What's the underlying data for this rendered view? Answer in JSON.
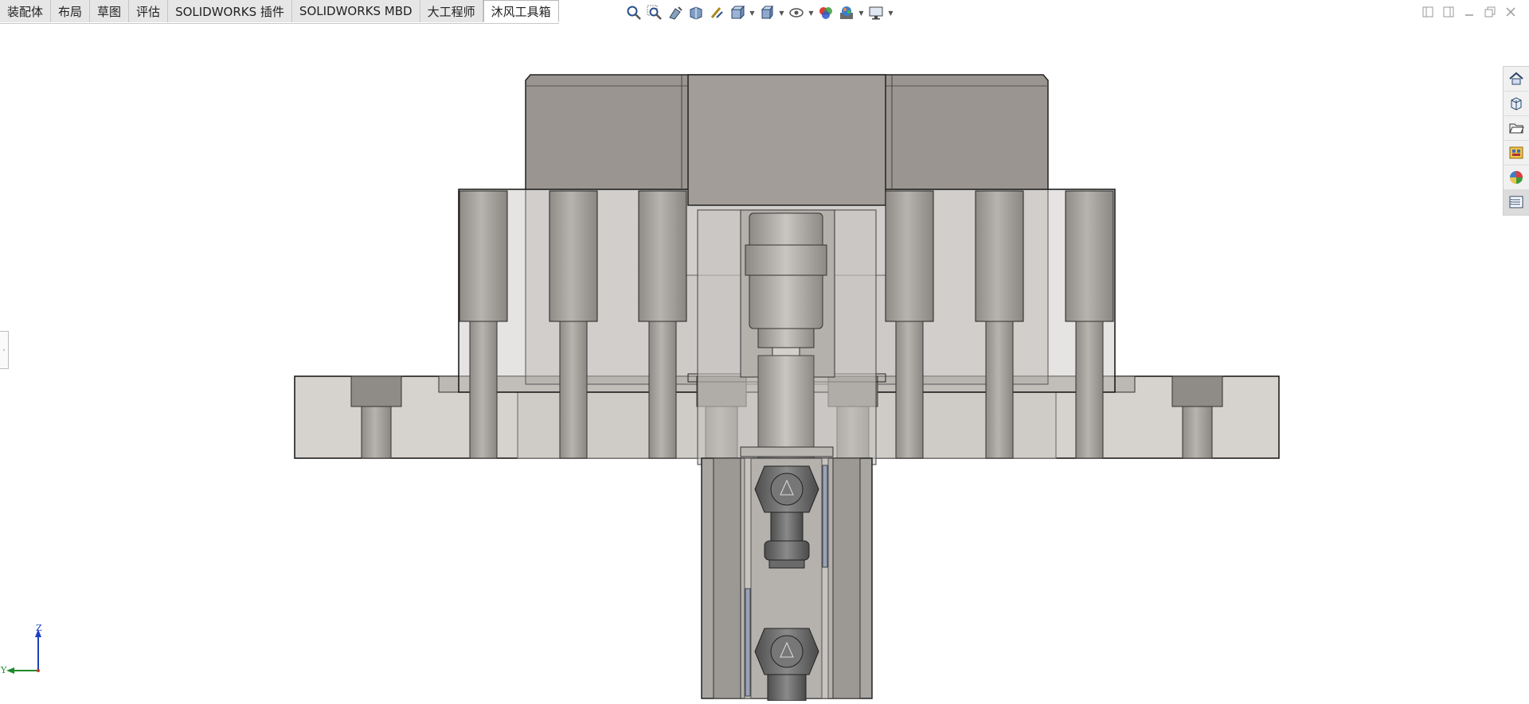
{
  "tabs": [
    {
      "label": "装配体",
      "active": false
    },
    {
      "label": "布局",
      "active": false
    },
    {
      "label": "草图",
      "active": false
    },
    {
      "label": "评估",
      "active": false
    },
    {
      "label": "SOLIDWORKS 插件",
      "active": false
    },
    {
      "label": "SOLIDWORKS MBD",
      "active": false
    },
    {
      "label": "大工程师",
      "active": false
    },
    {
      "label": "沐风工具箱",
      "active": true
    }
  ],
  "view_toolbar": {
    "icons": [
      "zoom-to-fit-icon",
      "zoom-to-area-icon",
      "previous-view-icon",
      "section-view-icon",
      "dynamic-annotation-icon",
      "view-orientation-icon",
      "display-style-icon",
      "hide-show-items-icon",
      "edit-appearance-icon",
      "apply-scene-icon",
      "view-settings-icon"
    ]
  },
  "task_pane": {
    "icons": [
      "home-icon",
      "parts-library-icon",
      "file-explorer-icon",
      "view-palette-icon",
      "appearances-icon",
      "custom-properties-icon"
    ]
  },
  "triad": {
    "axis_vertical": "Z",
    "axis_horizontal": "Y"
  },
  "colors": {
    "tab_bg": "#e6e6e6",
    "model_dark": "#9d9994",
    "model_light": "#d4d0cc",
    "axis_z": "#1f3fbf",
    "axis_y": "#1e8a2a"
  }
}
